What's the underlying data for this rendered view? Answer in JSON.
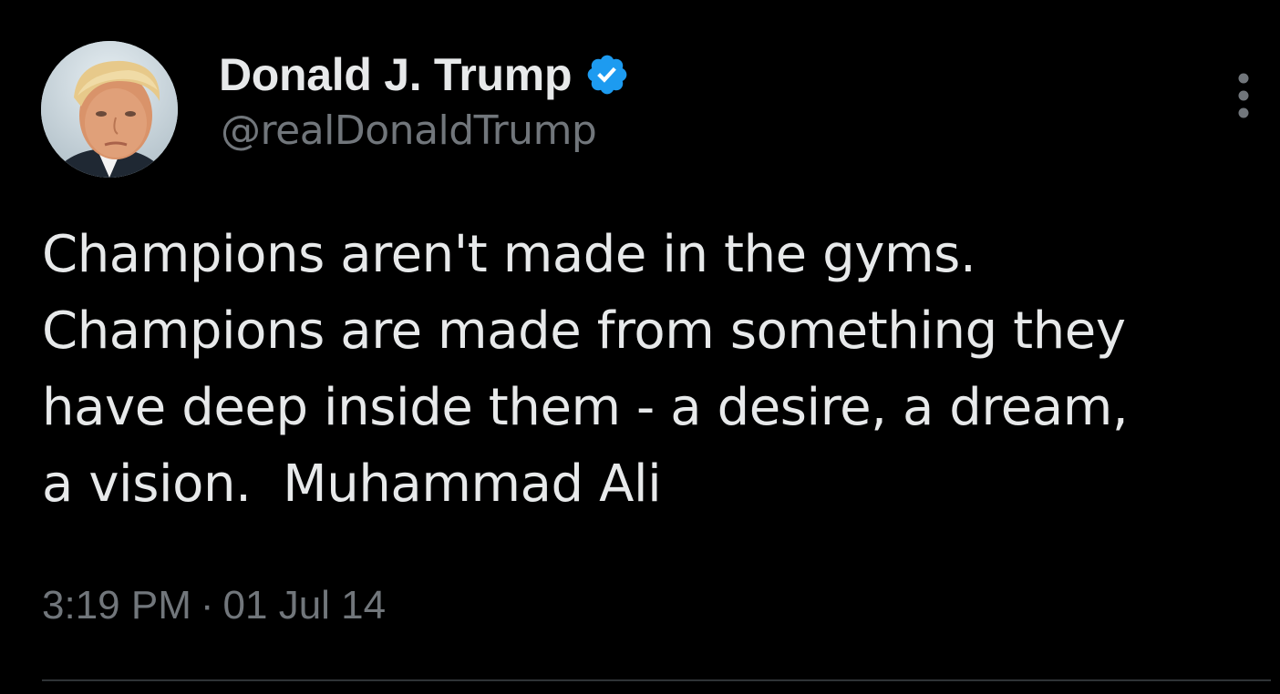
{
  "author": {
    "display_name": "Donald J. Trump",
    "handle": "@realDonaldTrump",
    "verified": true,
    "verified_color": "#1d9bf0"
  },
  "tweet": {
    "text": "Champions aren't made in the gyms.\nChampions are made from something they\nhave deep inside them - a desire, a dream,\na vision.  Muhammad Ali",
    "time": "3:19 PM",
    "separator": "·",
    "date": "01 Jul 14"
  },
  "icons": {
    "avatar": "profile-photo",
    "verified": "verified-badge-icon",
    "more": "more-vertical-icon"
  },
  "colors": {
    "background": "#000000",
    "primary_text": "#e7e9ea",
    "secondary_text": "#71767b",
    "divider": "#2f3336"
  }
}
